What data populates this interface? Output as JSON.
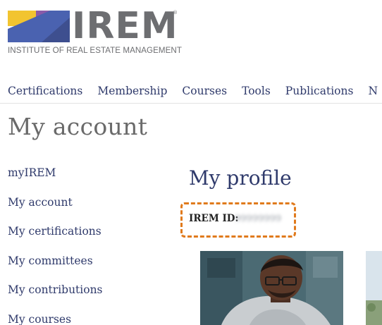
{
  "brand": {
    "name": "IREM",
    "registered_mark": "®",
    "tagline": "INSTITUTE OF REAL ESTATE MANAGEMENT",
    "colors": {
      "yellow": "#f2c430",
      "purple": "#8a5aa8",
      "magenta": "#b5306e",
      "blue": "#4a62b0",
      "slate": "#3e4f8f",
      "wordmark_gray": "#6d6e71"
    }
  },
  "top_nav": {
    "items": [
      {
        "label": "Certifications"
      },
      {
        "label": "Membership"
      },
      {
        "label": "Courses"
      },
      {
        "label": "Tools"
      },
      {
        "label": "Publications"
      },
      {
        "label": "N"
      }
    ]
  },
  "page": {
    "title": "My account"
  },
  "side_nav": {
    "items": [
      {
        "label": "myIREM"
      },
      {
        "label": "My account"
      },
      {
        "label": "My certifications"
      },
      {
        "label": "My committees"
      },
      {
        "label": "My contributions"
      },
      {
        "label": "My courses"
      }
    ]
  },
  "profile": {
    "title": "My profile",
    "id_label": "IREM ID:",
    "id_value": "99999999",
    "highlight_color": "#e07a1c"
  },
  "theme": {
    "link_color": "#2f3a6b",
    "title_gray": "#6a6a6a"
  }
}
